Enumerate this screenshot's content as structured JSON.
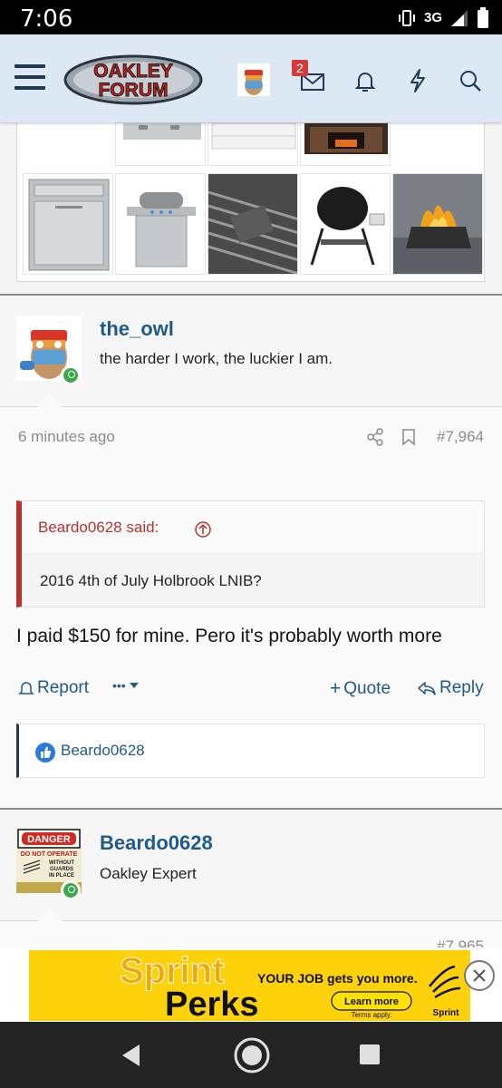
{
  "status_bar": {
    "time": "7:06",
    "network": "3G"
  },
  "header": {
    "logo_line1": "OAKLEY",
    "logo_line2": "FORUM",
    "inbox_count": "2",
    "icons": [
      "menu-icon",
      "avatar",
      "inbox-icon",
      "bell-icon",
      "bolt-icon",
      "search-icon"
    ]
  },
  "post1": {
    "username": "the_owl",
    "user_title": "the harder I work, the luckier I am.",
    "time": "6 minutes ago",
    "post_number": "#7,964",
    "quote": {
      "author": "Beardo0628 said:",
      "text": "2016 4th of July Holbrook LNIB?"
    },
    "message": "I paid $150 for mine. Pero it's probably worth more",
    "actions": {
      "report": "Report",
      "more": "•••",
      "quote": "Quote",
      "reply": "Reply"
    },
    "reaction_user": "Beardo0628"
  },
  "post2": {
    "username": "Beardo0628",
    "user_title": "Oakley Expert",
    "avatar_sign_title": "DANGER",
    "avatar_sign_text1": "DO NOT OPERATE",
    "avatar_sign_text2": "WITHOUT",
    "avatar_sign_text3": "GUARDS",
    "avatar_sign_text4": "IN PLACE",
    "meta_partial": "#7,965"
  },
  "ad": {
    "brand1": "Sprint",
    "brand2": "Perks",
    "tagline": "YOUR JOB gets you more.",
    "cta": "Learn more",
    "fine": "Terms apply.",
    "logo_text": "Sprint"
  },
  "colors": {
    "header_bg": "#dce9f5",
    "link": "#1f5a8a",
    "quote_accent": "#b8312f",
    "online": "#3aa84b",
    "ad_bg": "#fdd20a"
  }
}
